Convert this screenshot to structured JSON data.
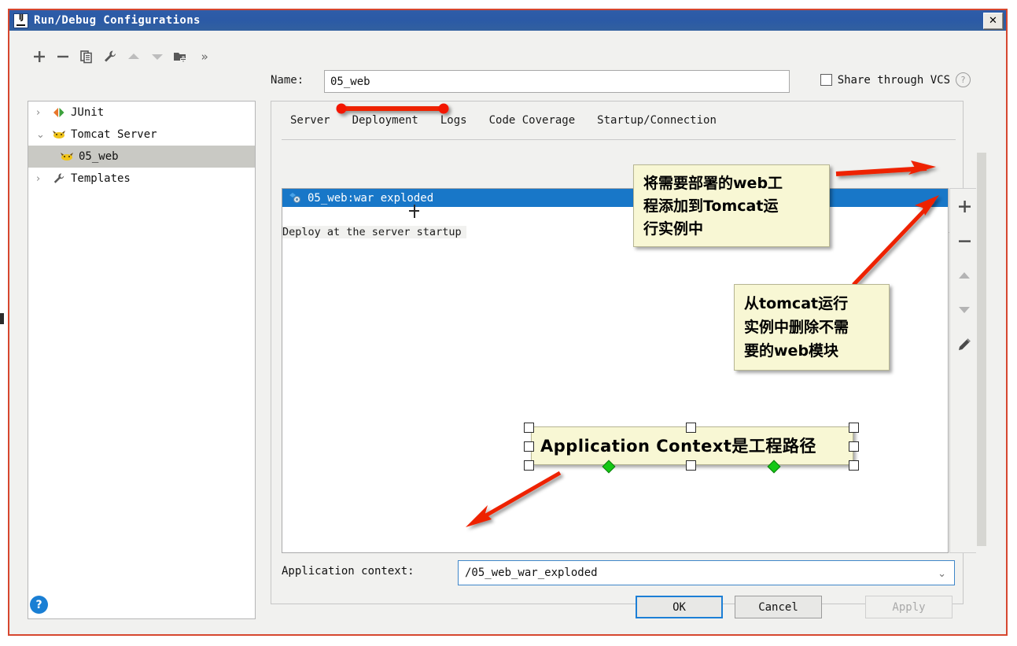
{
  "window": {
    "title": "Run/Debug Configurations",
    "logo_text": "IJ",
    "close_label": "✕"
  },
  "toolbar": {
    "buttons": [
      {
        "name": "add",
        "icon": "plus-icon"
      },
      {
        "name": "remove",
        "icon": "minus-icon"
      },
      {
        "name": "copy",
        "icon": "copy-icon"
      },
      {
        "name": "edit-templates",
        "icon": "wrench-icon"
      },
      {
        "name": "move-up",
        "icon": "arrow-up-icon"
      },
      {
        "name": "move-down",
        "icon": "arrow-down-icon"
      },
      {
        "name": "new-folder",
        "icon": "folder-add-icon"
      },
      {
        "name": "more",
        "icon": "chevron-double-right-icon",
        "label": "»"
      }
    ]
  },
  "name_field": {
    "label": "Name:",
    "value": "05_web",
    "placeholder": ""
  },
  "share_vcs": {
    "label": "Share through VCS",
    "checked": false,
    "help": "?"
  },
  "tree": {
    "items": [
      {
        "label": "JUnit",
        "twisty": "›",
        "icon": "junit-icon",
        "selected": false,
        "indent": 0
      },
      {
        "label": "Tomcat Server",
        "twisty": "⌄",
        "icon": "tomcat-icon",
        "selected": false,
        "indent": 0
      },
      {
        "label": "05_web",
        "twisty": "",
        "icon": "tomcat-icon",
        "selected": true,
        "indent": 1
      },
      {
        "label": "Templates",
        "twisty": "›",
        "icon": "wrench-icon",
        "selected": false,
        "indent": 0
      }
    ]
  },
  "tabs": [
    {
      "label": "Server",
      "active": false
    },
    {
      "label": "Deployment",
      "active": true
    },
    {
      "label": "Logs",
      "active": false
    },
    {
      "label": "Code Coverage",
      "active": false
    },
    {
      "label": "Startup/Connection",
      "active": false
    }
  ],
  "deployment": {
    "section_label": "Deploy at the server startup",
    "rows": [
      {
        "label": "05_web:war exploded",
        "icon": "artifact-icon",
        "selected": true
      }
    ],
    "side_buttons": [
      {
        "name": "add-artifact",
        "icon": "plus-icon",
        "disabled": false
      },
      {
        "name": "remove-artifact",
        "icon": "minus-icon",
        "disabled": false
      },
      {
        "name": "move-artifact-up",
        "icon": "arrow-up-icon",
        "disabled": true
      },
      {
        "name": "move-artifact-down",
        "icon": "arrow-down-icon",
        "disabled": true
      },
      {
        "name": "edit-artifact",
        "icon": "pencil-icon",
        "disabled": false
      }
    ]
  },
  "app_context": {
    "label": "Application context:",
    "value": "/05_web_war_exploded",
    "chevron": "⌄"
  },
  "footer": {
    "help": "?",
    "ok": "OK",
    "cancel": "Cancel",
    "apply": "Apply"
  },
  "annotations": [
    {
      "name": "callout-add-web-module",
      "text": "将需要部署的web工\n程添加到Tomcat运\n行实例中"
    },
    {
      "name": "callout-remove-web-module",
      "text": "从tomcat运行\n实例中删除不需\n要的web模块"
    },
    {
      "name": "callout-application-context",
      "text": "Application Context是工程路径"
    }
  ],
  "annotation_texts": {
    "add_line1": "将需要部署的web工",
    "add_line2": "程添加到Tomcat运",
    "add_line3": "行实例中",
    "remove_line1": "从tomcat运行",
    "remove_line2": "实例中删除不需",
    "remove_line3": "要的web模块",
    "ctx_text": "Application Context是工程路径"
  },
  "colors": {
    "window_border": "#d6472f",
    "titlebar": "#2e5ca8",
    "selection_blue": "#1877c8",
    "callout_bg": "#f8f7d4",
    "annotation_red": "#ee2200",
    "accent_focus": "#1d7fd6",
    "handle_green": "#14c814"
  }
}
